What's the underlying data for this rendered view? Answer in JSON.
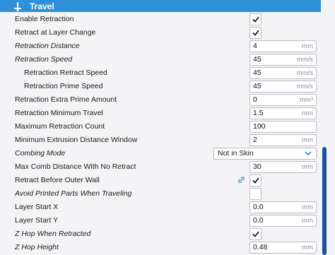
{
  "header": {
    "title": "Travel",
    "icon": "travel-icon"
  },
  "rows": [
    {
      "label": "Enable Retraction",
      "type": "check",
      "checked": true
    },
    {
      "label": "Retract at Layer Change",
      "type": "check",
      "checked": true
    },
    {
      "label": "Retraction Distance",
      "type": "field",
      "value": "4",
      "unit": "mm"
    },
    {
      "label": "Retraction Speed",
      "type": "field",
      "value": "45",
      "unit": "mm/s"
    },
    {
      "label": "Retraction Retract Speed",
      "type": "field",
      "value": "45",
      "unit": "mm/s"
    },
    {
      "label": "Retraction Prime Speed",
      "type": "field",
      "value": "45",
      "unit": "mm/s"
    },
    {
      "label": "Retraction Extra Prime Amount",
      "type": "field",
      "value": "0",
      "unit": "mm³"
    },
    {
      "label": "Retraction Minimum Travel",
      "type": "field",
      "value": "1.5",
      "unit": "mm"
    },
    {
      "label": "Maximum Retraction Count",
      "type": "field",
      "value": "100",
      "unit": ""
    },
    {
      "label": "Minimum Extrusion Distance Window",
      "type": "field",
      "value": "2",
      "unit": "mm"
    },
    {
      "label": "Combing Mode",
      "type": "select",
      "value": "Not in Skin"
    },
    {
      "label": "Max Comb Distance With No Retract",
      "type": "field",
      "value": "30",
      "unit": "mm"
    },
    {
      "label": "Retract Before Outer Wall",
      "type": "check",
      "checked": true
    },
    {
      "label": "Avoid Printed Parts When Traveling",
      "type": "check",
      "checked": false
    },
    {
      "label": "Layer Start X",
      "type": "field",
      "value": "0.0",
      "unit": "mm"
    },
    {
      "label": "Layer Start Y",
      "type": "field",
      "value": "0.0",
      "unit": "mm"
    },
    {
      "label": "Z Hop When Retracted",
      "type": "check",
      "checked": true
    },
    {
      "label": "Z Hop Height",
      "type": "field",
      "value": "0.48",
      "unit": "mm"
    }
  ],
  "colors": {
    "accent": "#2f8fd8",
    "scrollbar": "#1f4fa0",
    "link": "#2f8fd8"
  }
}
